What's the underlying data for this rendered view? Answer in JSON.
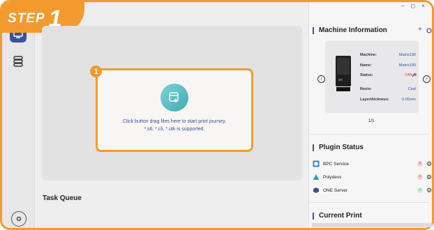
{
  "step": {
    "word": "STEP",
    "number": "1"
  },
  "main": {
    "marker": "1",
    "drop_line1": "Click button drag files here to start print journey.",
    "drop_line2": "*.stl, *.cli, *.utk is supported.",
    "task_queue": "Task Queue"
  },
  "window": {
    "minimize": "–",
    "maximize": "◻",
    "close": "×"
  },
  "machine": {
    "title": "Machine Information",
    "add": "+",
    "rows": [
      {
        "key": "Machine:",
        "value": "Matrix190"
      },
      {
        "key": "Name:",
        "value": "Matrix190"
      },
      {
        "key": "Status:",
        "value": "Offline"
      },
      {
        "key": "Resin:",
        "value": "Cast"
      },
      {
        "key": "Layerthickness:",
        "value": "0.05mm"
      }
    ],
    "pager": "1/1"
  },
  "plugins": {
    "title": "Plugin Status",
    "items": [
      {
        "label": "BPC Service",
        "status": "error"
      },
      {
        "label": "Polydevs",
        "status": "error"
      },
      {
        "label": "ONE Server",
        "status": "ok"
      }
    ]
  },
  "current_print": {
    "title": "Current Print"
  },
  "colors": {
    "accent": "#f39a2e",
    "brand": "#3d4f9e",
    "ok": "#4caf50",
    "error": "#e0463c"
  }
}
